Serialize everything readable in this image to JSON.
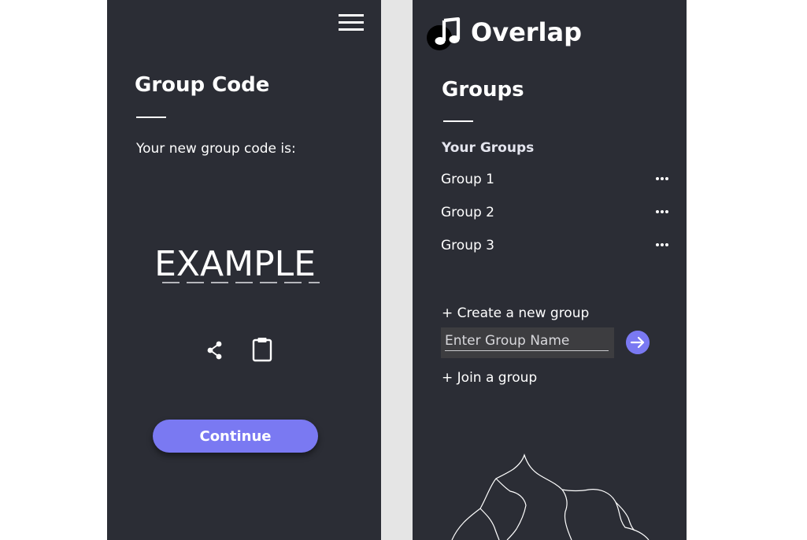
{
  "group_code_screen": {
    "title": "Group Code",
    "prompt": "Your new group code is:",
    "code": "EXAMPLE",
    "continue_label": "Continue",
    "icons": [
      "menu-icon",
      "share-icon",
      "clipboard-icon"
    ]
  },
  "groups_screen": {
    "app_name": "Overlap",
    "logo_icon": "music-note-icon",
    "title": "Groups",
    "section_label": "Your Groups",
    "groups": [
      {
        "label": "Group 1"
      },
      {
        "label": "Group 2"
      },
      {
        "label": "Group 3"
      }
    ],
    "create_label": "+ Create a new group",
    "group_name_placeholder": "Enter Group Name",
    "join_label": "+ Join a group"
  },
  "colors": {
    "panel_bg": "#2b2d35",
    "accent": "#7a79f2",
    "divider": "#e5e5e5",
    "input_bg": "#3d3d40"
  }
}
